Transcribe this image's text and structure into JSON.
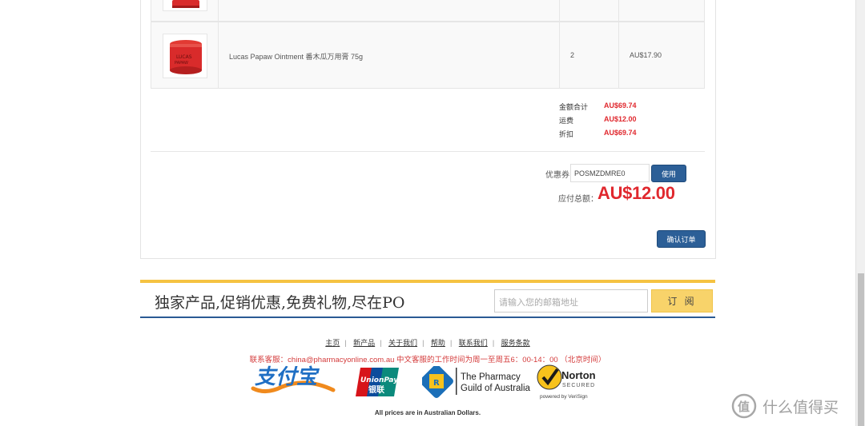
{
  "cart": {
    "product": {
      "name": "Lucas Papaw Ointment 番木瓜万用膏 75g",
      "quantity": "2",
      "price": "AU$17.90"
    },
    "summary": [
      {
        "label": "金额合计",
        "value": "AU$69.74"
      },
      {
        "label": "运费",
        "value": "AU$12.00"
      },
      {
        "label": "折扣",
        "value": "AU$69.74"
      }
    ],
    "coupon": {
      "label": "优惠券",
      "value": "POSMZDMRE0",
      "apply_label": "使用"
    },
    "total": {
      "label": "应付总额：",
      "value": "AU$12.00"
    },
    "confirm_label": "确认订单"
  },
  "newsletter": {
    "headline": "独家产品,促销优惠,免费礼物,尽在PO",
    "placeholder": "请输入您的邮箱地址",
    "subscribe_label": "订 阅"
  },
  "footer": {
    "links": [
      "主页",
      "新产品",
      "关于我们",
      "帮助",
      "联系我们",
      "服务条款"
    ],
    "contact": "联系客服：china@pharmacyonline.com.au 中文客服的工作时间为周一至周五6：00-14：00 （北京时间）",
    "logos": {
      "unionpay_en": "UnionPay",
      "unionpay_cn": "银联",
      "guild_line1": "The Pharmacy",
      "guild_line2": "Guild of Australia",
      "norton_name": "Norton",
      "norton_secured": "SECURED",
      "norton_powered": "powered by VeriSign"
    },
    "note": "All prices are in Australian Dollars."
  },
  "watermark": {
    "text": "什么值得买"
  },
  "colors": {
    "brand_blue": "#2c5f97",
    "price_red": "#e0282e",
    "accent_yellow": "#f5c342"
  }
}
